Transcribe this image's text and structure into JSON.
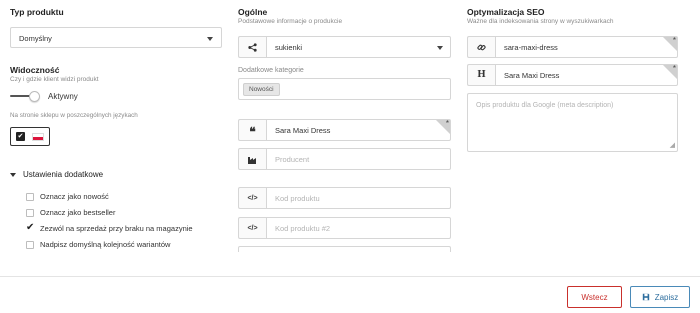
{
  "left": {
    "product_type": {
      "heading": "Typ produktu",
      "value": "Domyślny"
    },
    "visibility": {
      "heading": "Widoczność",
      "subtitle": "Czy i gdzie klient widzi produkt",
      "toggle_label": "Aktywny",
      "languages_label": "Na stronie sklepu w poszczególnych językach"
    },
    "additional_settings": {
      "heading": "Ustawienia dodatkowe",
      "options": [
        {
          "label": "Oznacz jako nowość",
          "checked": false
        },
        {
          "label": "Oznacz jako bestseller",
          "checked": false
        },
        {
          "label": "Zezwól na sprzedaż przy braku na magazynie",
          "checked": true
        },
        {
          "label": "Nadpisz domyślną kolejność wariantów",
          "checked": false
        }
      ]
    }
  },
  "general": {
    "heading": "Ogólne",
    "subtitle": "Podstawowe informacje o produkcie",
    "category": "sukienki",
    "additional_categories_label": "Dodatkowe kategorie",
    "additional_categories_tag": "Nowości",
    "name": "Sara Maxi Dress",
    "producer_placeholder": "Producent",
    "product_code_placeholder": "Kod produktu",
    "product_code2_placeholder": "Kod produktu #2"
  },
  "seo": {
    "heading": "Optymalizacja SEO",
    "subtitle": "Ważne dla indeksowania strony w wyszukiwarkach",
    "slug": "sara-maxi-dress",
    "title": "Sara Maxi Dress",
    "description_placeholder": "Opis produktu dla Google (meta description)"
  },
  "footer": {
    "back_label": "Wstecz",
    "save_label": "Zapisz"
  },
  "colors": {
    "back_border": "#c9302c",
    "back_text": "#c9302c",
    "save_border": "#4a8ab8",
    "save_text": "#2f6f9f",
    "checkbox_active": "#222222"
  },
  "icons": [
    "chevron-down-icon",
    "share-icon",
    "quote-icon",
    "factory-icon",
    "code-icon",
    "link-icon",
    "heading-icon",
    "save-icon"
  ]
}
